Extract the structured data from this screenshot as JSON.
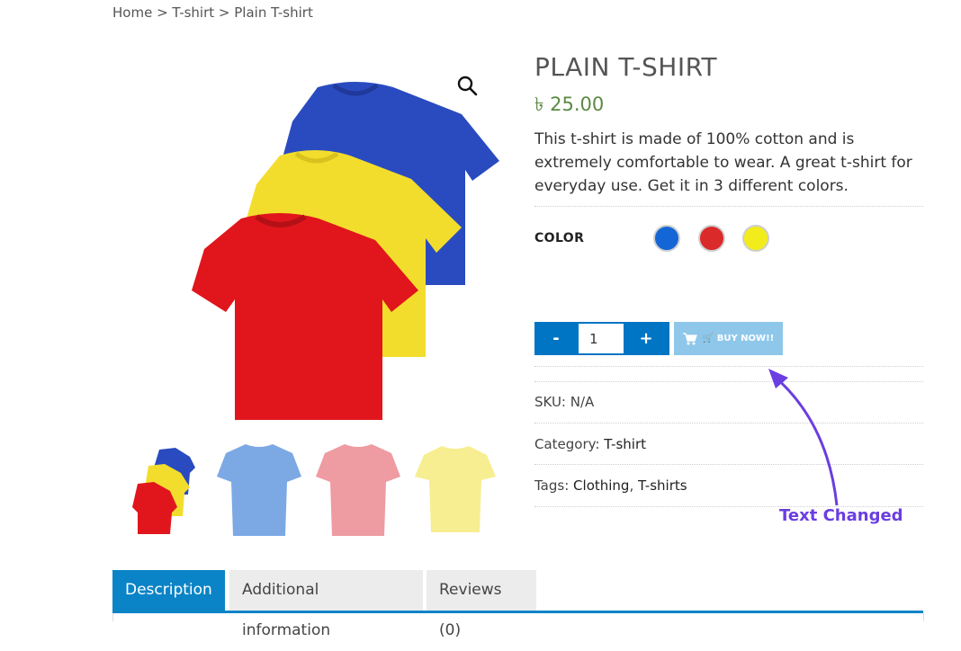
{
  "breadcrumb": {
    "home": "Home",
    "sep1": " > ",
    "category": "T-shirt",
    "sep2": " > ",
    "current": "Plain T-shirt"
  },
  "product": {
    "title": "PLAIN T-SHIRT",
    "price": "৳ 25.00",
    "description": "This t-shirt is made of 100% cotton and is extremely comfortable to wear. A great t-shirt for everyday use. Get it in 3 different colors."
  },
  "variations": {
    "label": "COLOR",
    "colors": [
      {
        "name": "blue",
        "hex": "#1466d6"
      },
      {
        "name": "red",
        "hex": "#da2a2a"
      },
      {
        "name": "yellow",
        "hex": "#f2ec1b"
      }
    ]
  },
  "cart": {
    "minus": "-",
    "plus": "+",
    "quantity": "1",
    "buy_label": "🛒 BUY NOW!!"
  },
  "meta": {
    "sku_label": "SKU:",
    "sku_value": "N/A",
    "category_label": "Category:",
    "category_value": "T-shirt",
    "tags_label": "Tags:",
    "tags": [
      "Clothing",
      "T-shirts"
    ],
    "tags_sep": ", "
  },
  "annotation": {
    "text": "Text Changed",
    "color": "#6a3ee0"
  },
  "tabs": [
    {
      "label": "Description"
    },
    {
      "label": "Additional information"
    },
    {
      "label": "Reviews (0)"
    }
  ],
  "colors": {
    "accent": "#0a84c6",
    "price": "#5b8a43",
    "buy_disabled": "#8ec7ea"
  }
}
